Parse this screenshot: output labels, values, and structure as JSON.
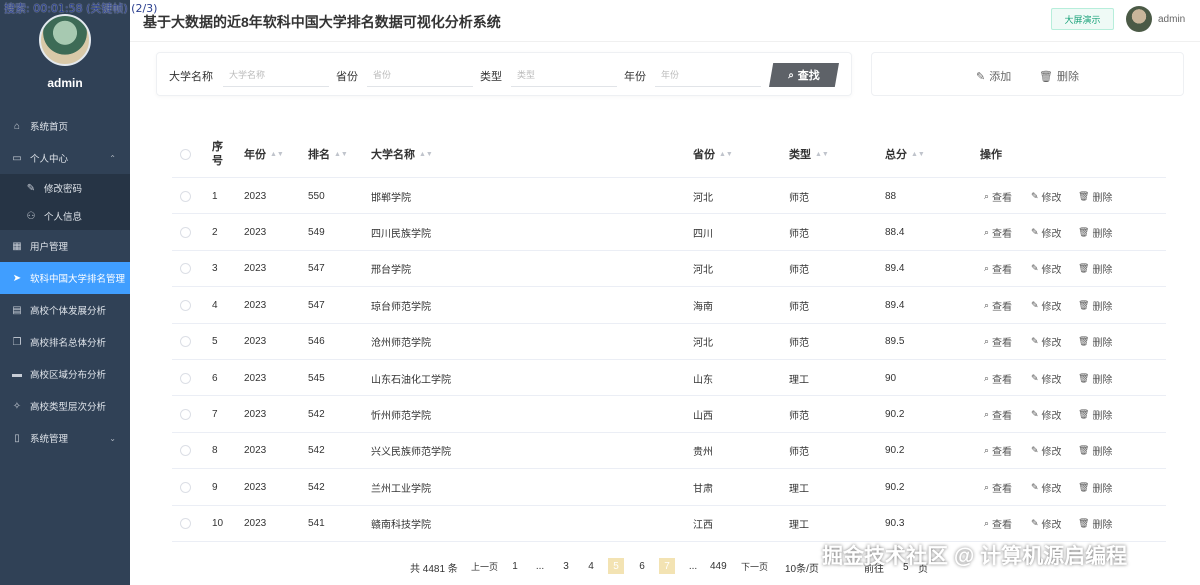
{
  "overlay": {
    "search_text": "搜索: 00:01:58 (关键帧) (2/3)"
  },
  "sidebar": {
    "username": "admin",
    "items": [
      {
        "label": "系统首页",
        "icon": "home-icon"
      },
      {
        "label": "个人中心",
        "icon": "user-center-icon"
      },
      {
        "label": "修改密码",
        "icon": "edit-icon"
      },
      {
        "label": "个人信息",
        "icon": "user-icon"
      },
      {
        "label": "用户管理",
        "icon": "user-manage-icon"
      },
      {
        "label": "软科中国大学排名管理",
        "icon": "paper-plane-icon"
      },
      {
        "label": "高校个体发展分析",
        "icon": "chat-icon"
      },
      {
        "label": "高校排名总体分析",
        "icon": "copy-icon"
      },
      {
        "label": "高校区域分布分析",
        "icon": "printer-icon"
      },
      {
        "label": "高校类型层次分析",
        "icon": "tag-icon"
      },
      {
        "label": "系统管理",
        "icon": "phone-icon"
      }
    ]
  },
  "header": {
    "title": "基于大数据的近8年软科中国大学排名数据可视化分析系统",
    "bigscreen_label": "大屏演示",
    "username": "admin"
  },
  "search": {
    "fields": [
      {
        "label": "大学名称",
        "placeholder": "大学名称"
      },
      {
        "label": "省份",
        "placeholder": "省份"
      },
      {
        "label": "类型",
        "placeholder": "类型"
      },
      {
        "label": "年份",
        "placeholder": "年份"
      }
    ],
    "button_label": "查找"
  },
  "actions": {
    "add_label": "添加",
    "delete_label": "删除"
  },
  "table": {
    "headers": [
      "序号",
      "年份",
      "排名",
      "大学名称",
      "省份",
      "类型",
      "总分",
      "操作"
    ],
    "header_index_line1": "序",
    "header_index_line2": "号",
    "row_actions": {
      "view": "查看",
      "edit": "修改",
      "delete": "删除"
    },
    "rows": [
      [
        "1",
        "2023",
        "550",
        "邯郸学院",
        "河北",
        "师范",
        "88"
      ],
      [
        "2",
        "2023",
        "549",
        "四川民族学院",
        "四川",
        "师范",
        "88.4"
      ],
      [
        "3",
        "2023",
        "547",
        "邢台学院",
        "河北",
        "师范",
        "89.4"
      ],
      [
        "4",
        "2023",
        "547",
        "琼台师范学院",
        "海南",
        "师范",
        "89.4"
      ],
      [
        "5",
        "2023",
        "546",
        "沧州师范学院",
        "河北",
        "师范",
        "89.5"
      ],
      [
        "6",
        "2023",
        "545",
        "山东石油化工学院",
        "山东",
        "理工",
        "90"
      ],
      [
        "7",
        "2023",
        "542",
        "忻州师范学院",
        "山西",
        "师范",
        "90.2"
      ],
      [
        "8",
        "2023",
        "542",
        "兴义民族师范学院",
        "贵州",
        "师范",
        "90.2"
      ],
      [
        "9",
        "2023",
        "542",
        "兰州工业学院",
        "甘肃",
        "理工",
        "90.2"
      ],
      [
        "10",
        "2023",
        "541",
        "赣南科技学院",
        "江西",
        "理工",
        "90.3"
      ]
    ]
  },
  "pagination": {
    "total": "共 4481 条",
    "prev": "上一页",
    "pages": [
      "1",
      "...",
      "3",
      "4",
      "5",
      "6",
      "7",
      "...",
      "449"
    ],
    "next": "下一页",
    "page_size": "10条/页",
    "goto_label": "前往",
    "goto_value": "5",
    "goto_suffix": "页"
  },
  "watermark": "掘金技术社区 @ 计算机源启编程"
}
